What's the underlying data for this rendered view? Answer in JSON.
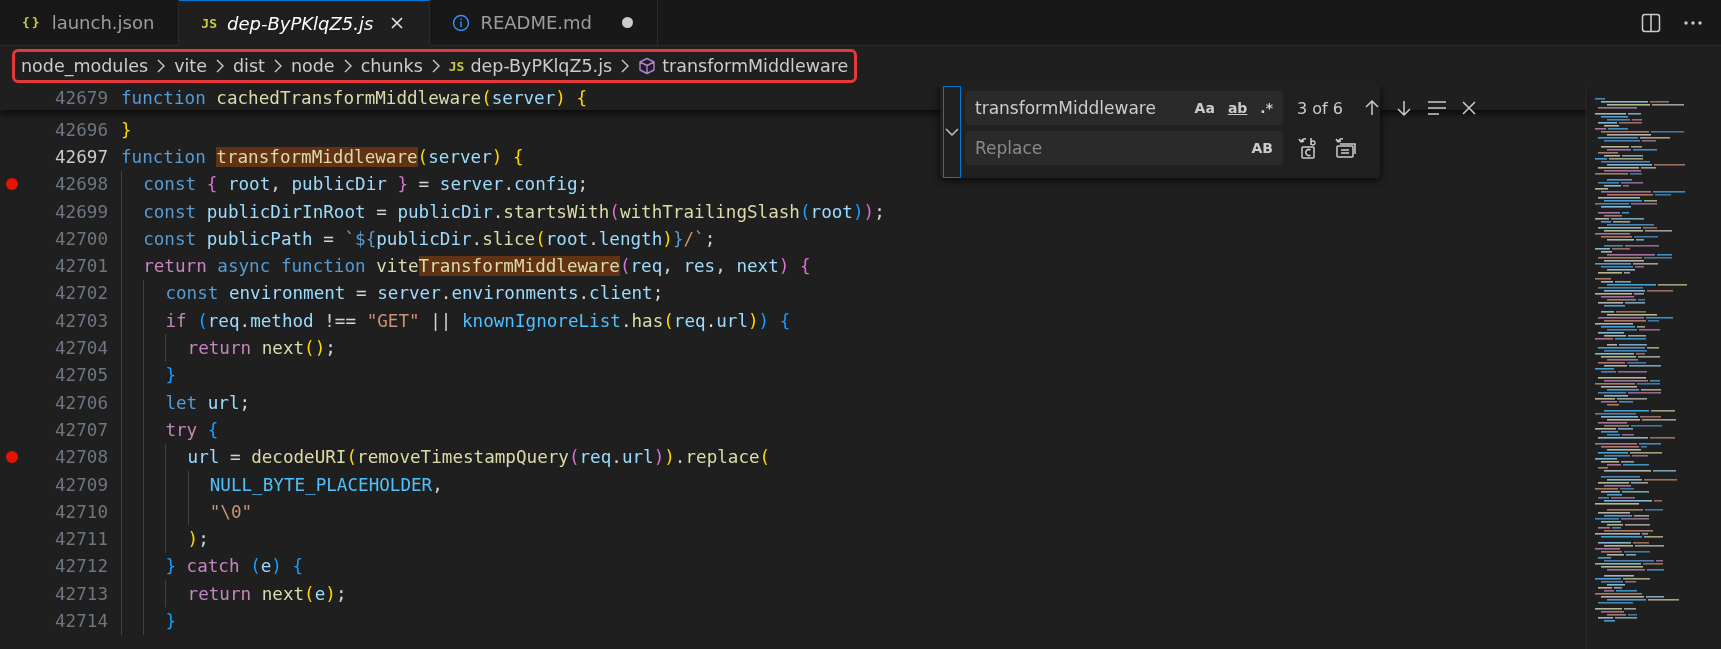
{
  "tabs": [
    {
      "label": "launch.json",
      "icon_text": "{}",
      "kind": "json",
      "selected": false,
      "preview": false,
      "dirty": false,
      "closable": false
    },
    {
      "label": "dep-ByPKlqZ5.js",
      "icon_text": "JS",
      "kind": "js",
      "selected": true,
      "preview": true,
      "dirty": false,
      "closable": true
    },
    {
      "label": "README.md",
      "kind": "info",
      "selected": false,
      "preview": false,
      "dirty": true,
      "closable": false
    }
  ],
  "editor_actions": [
    {
      "kind": "split"
    },
    {
      "kind": "more"
    }
  ],
  "breadcrumbs": {
    "highlighted": true,
    "items": [
      {
        "label": "node_modules"
      },
      {
        "label": "vite"
      },
      {
        "label": "dist"
      },
      {
        "label": "node"
      },
      {
        "label": "chunks"
      },
      {
        "label": "dep-ByPKlqZ5.js",
        "icon_text": "JS",
        "kind": "js"
      },
      {
        "label": "transformMiddleware",
        "kind": "symbol"
      }
    ]
  },
  "sticky_line": {
    "number": "42679",
    "tokens": [
      {
        "kind": "keyword",
        "text": "function "
      },
      {
        "kind": "func",
        "text": "cachedTransformMiddleware"
      },
      {
        "kind": "bracket1",
        "text": "("
      },
      {
        "kind": "var",
        "text": "server"
      },
      {
        "kind": "bracket1",
        "text": ") "
      },
      {
        "kind": "bracket1",
        "text": "{"
      }
    ]
  },
  "lines": [
    {
      "number": "42696",
      "breakpoint": false,
      "current": false,
      "tokens": [
        {
          "kind": "bracket1",
          "text": "}"
        }
      ]
    },
    {
      "number": "42697",
      "breakpoint": false,
      "current": true,
      "tokens": [
        {
          "kind": "keyword",
          "text": "function "
        },
        {
          "kind": "func",
          "text": "transformMiddleware",
          "match": true
        },
        {
          "kind": "bracket1",
          "text": "("
        },
        {
          "kind": "var",
          "text": "server"
        },
        {
          "kind": "bracket1",
          "text": ") "
        },
        {
          "kind": "bracket1",
          "text": "{"
        }
      ]
    },
    {
      "number": "42698",
      "breakpoint": true,
      "current": false,
      "tokens": [
        {
          "kind": "keyword",
          "text": "  const "
        },
        {
          "kind": "bracket2",
          "text": "{ "
        },
        {
          "kind": "var",
          "text": "root"
        },
        {
          "kind": "plain",
          "text": ", "
        },
        {
          "kind": "var",
          "text": "publicDir "
        },
        {
          "kind": "bracket2",
          "text": "}"
        },
        {
          "kind": "plain",
          "text": " = "
        },
        {
          "kind": "var",
          "text": "server"
        },
        {
          "kind": "plain",
          "text": "."
        },
        {
          "kind": "var",
          "text": "config"
        },
        {
          "kind": "plain",
          "text": ";"
        }
      ]
    },
    {
      "number": "42699",
      "breakpoint": false,
      "current": false,
      "tokens": [
        {
          "kind": "keyword",
          "text": "  const "
        },
        {
          "kind": "var",
          "text": "publicDirInRoot"
        },
        {
          "kind": "plain",
          "text": " = "
        },
        {
          "kind": "var",
          "text": "publicDir"
        },
        {
          "kind": "plain",
          "text": "."
        },
        {
          "kind": "func",
          "text": "startsWith"
        },
        {
          "kind": "bracket2",
          "text": "("
        },
        {
          "kind": "func",
          "text": "withTrailingSlash"
        },
        {
          "kind": "bracket3",
          "text": "("
        },
        {
          "kind": "var",
          "text": "root"
        },
        {
          "kind": "bracket3",
          "text": ")"
        },
        {
          "kind": "bracket2",
          "text": ")"
        },
        {
          "kind": "plain",
          "text": ";"
        }
      ]
    },
    {
      "number": "42700",
      "breakpoint": false,
      "current": false,
      "tokens": [
        {
          "kind": "keyword",
          "text": "  const "
        },
        {
          "kind": "var",
          "text": "publicPath"
        },
        {
          "kind": "plain",
          "text": " = "
        },
        {
          "kind": "string",
          "text": "`"
        },
        {
          "kind": "keyword",
          "text": "${"
        },
        {
          "kind": "var",
          "text": "publicDir"
        },
        {
          "kind": "plain",
          "text": "."
        },
        {
          "kind": "func",
          "text": "slice"
        },
        {
          "kind": "bracket1",
          "text": "("
        },
        {
          "kind": "var",
          "text": "root"
        },
        {
          "kind": "plain",
          "text": "."
        },
        {
          "kind": "var",
          "text": "length"
        },
        {
          "kind": "bracket1",
          "text": ")"
        },
        {
          "kind": "keyword",
          "text": "}"
        },
        {
          "kind": "string",
          "text": "/`"
        },
        {
          "kind": "plain",
          "text": ";"
        }
      ]
    },
    {
      "number": "42701",
      "breakpoint": false,
      "current": false,
      "tokens": [
        {
          "kind": "control",
          "text": "  return "
        },
        {
          "kind": "keyword",
          "text": "async function "
        },
        {
          "kind": "func",
          "text": "vite"
        },
        {
          "kind": "func",
          "text": "TransformMiddleware",
          "match": true
        },
        {
          "kind": "bracket2",
          "text": "("
        },
        {
          "kind": "var",
          "text": "req"
        },
        {
          "kind": "plain",
          "text": ", "
        },
        {
          "kind": "var",
          "text": "res"
        },
        {
          "kind": "plain",
          "text": ", "
        },
        {
          "kind": "var",
          "text": "next"
        },
        {
          "kind": "bracket2",
          "text": ") "
        },
        {
          "kind": "bracket2",
          "text": "{"
        }
      ]
    },
    {
      "number": "42702",
      "breakpoint": false,
      "current": false,
      "tokens": [
        {
          "kind": "keyword",
          "text": "    const "
        },
        {
          "kind": "var",
          "text": "environment"
        },
        {
          "kind": "plain",
          "text": " = "
        },
        {
          "kind": "var",
          "text": "server"
        },
        {
          "kind": "plain",
          "text": "."
        },
        {
          "kind": "var",
          "text": "environments"
        },
        {
          "kind": "plain",
          "text": "."
        },
        {
          "kind": "var",
          "text": "client"
        },
        {
          "kind": "plain",
          "text": ";"
        }
      ]
    },
    {
      "number": "42703",
      "breakpoint": false,
      "current": false,
      "tokens": [
        {
          "kind": "control",
          "text": "    if "
        },
        {
          "kind": "bracket3",
          "text": "("
        },
        {
          "kind": "var",
          "text": "req"
        },
        {
          "kind": "plain",
          "text": "."
        },
        {
          "kind": "var",
          "text": "method"
        },
        {
          "kind": "plain",
          "text": " !== "
        },
        {
          "kind": "string",
          "text": "\"GET\""
        },
        {
          "kind": "plain",
          "text": " || "
        },
        {
          "kind": "constant",
          "text": "knownIgnoreList"
        },
        {
          "kind": "plain",
          "text": "."
        },
        {
          "kind": "func",
          "text": "has"
        },
        {
          "kind": "bracket1",
          "text": "("
        },
        {
          "kind": "var",
          "text": "req"
        },
        {
          "kind": "plain",
          "text": "."
        },
        {
          "kind": "var",
          "text": "url"
        },
        {
          "kind": "bracket1",
          "text": ")"
        },
        {
          "kind": "bracket3",
          "text": ") "
        },
        {
          "kind": "bracket3",
          "text": "{"
        }
      ]
    },
    {
      "number": "42704",
      "breakpoint": false,
      "current": false,
      "tokens": [
        {
          "kind": "control",
          "text": "      return "
        },
        {
          "kind": "func",
          "text": "next"
        },
        {
          "kind": "bracket1",
          "text": "()"
        },
        {
          "kind": "plain",
          "text": ";"
        }
      ]
    },
    {
      "number": "42705",
      "breakpoint": false,
      "current": false,
      "tokens": [
        {
          "kind": "bracket3",
          "text": "    }"
        }
      ]
    },
    {
      "number": "42706",
      "breakpoint": false,
      "current": false,
      "tokens": [
        {
          "kind": "keyword",
          "text": "    let "
        },
        {
          "kind": "var",
          "text": "url"
        },
        {
          "kind": "plain",
          "text": ";"
        }
      ]
    },
    {
      "number": "42707",
      "breakpoint": false,
      "current": false,
      "tokens": [
        {
          "kind": "control",
          "text": "    try "
        },
        {
          "kind": "bracket3",
          "text": "{"
        }
      ]
    },
    {
      "number": "42708",
      "breakpoint": true,
      "current": false,
      "tokens": [
        {
          "kind": "var",
          "text": "      url"
        },
        {
          "kind": "plain",
          "text": " = "
        },
        {
          "kind": "func",
          "text": "decodeURI"
        },
        {
          "kind": "bracket1",
          "text": "("
        },
        {
          "kind": "func",
          "text": "removeTimestampQuery"
        },
        {
          "kind": "bracket2",
          "text": "("
        },
        {
          "kind": "var",
          "text": "req"
        },
        {
          "kind": "plain",
          "text": "."
        },
        {
          "kind": "var",
          "text": "url"
        },
        {
          "kind": "bracket2",
          "text": ")"
        },
        {
          "kind": "bracket1",
          "text": ")"
        },
        {
          "kind": "plain",
          "text": "."
        },
        {
          "kind": "func",
          "text": "replace"
        },
        {
          "kind": "bracket1",
          "text": "("
        }
      ]
    },
    {
      "number": "42709",
      "breakpoint": false,
      "current": false,
      "tokens": [
        {
          "kind": "constant",
          "text": "        NULL_BYTE_PLACEHOLDER"
        },
        {
          "kind": "plain",
          "text": ","
        }
      ]
    },
    {
      "number": "42710",
      "breakpoint": false,
      "current": false,
      "tokens": [
        {
          "kind": "string",
          "text": "        \"\\0\""
        }
      ]
    },
    {
      "number": "42711",
      "breakpoint": false,
      "current": false,
      "tokens": [
        {
          "kind": "bracket1",
          "text": "      )"
        },
        {
          "kind": "plain",
          "text": ";"
        }
      ]
    },
    {
      "number": "42712",
      "breakpoint": false,
      "current": false,
      "tokens": [
        {
          "kind": "bracket3",
          "text": "    } "
        },
        {
          "kind": "control",
          "text": "catch "
        },
        {
          "kind": "bracket3",
          "text": "("
        },
        {
          "kind": "var",
          "text": "e"
        },
        {
          "kind": "bracket3",
          "text": ") "
        },
        {
          "kind": "bracket3",
          "text": "{"
        }
      ]
    },
    {
      "number": "42713",
      "breakpoint": false,
      "current": false,
      "tokens": [
        {
          "kind": "control",
          "text": "      return "
        },
        {
          "kind": "func",
          "text": "next"
        },
        {
          "kind": "bracket1",
          "text": "("
        },
        {
          "kind": "var",
          "text": "e"
        },
        {
          "kind": "bracket1",
          "text": ")"
        },
        {
          "kind": "plain",
          "text": ";"
        }
      ]
    },
    {
      "number": "42714",
      "breakpoint": false,
      "current": false,
      "tokens": [
        {
          "kind": "bracket3",
          "text": "    }"
        }
      ]
    }
  ],
  "find_widget": {
    "expanded": true,
    "find": {
      "value": "transformMiddleware",
      "options": [
        {
          "label": "Aa",
          "on": false
        },
        {
          "label": "ab",
          "on": false
        },
        {
          "label": ".*",
          "on": false
        }
      ]
    },
    "count": "3 of 6",
    "replace": {
      "placeholder": "Replace",
      "preserve_case": {
        "label": "AB",
        "on": false
      }
    }
  }
}
